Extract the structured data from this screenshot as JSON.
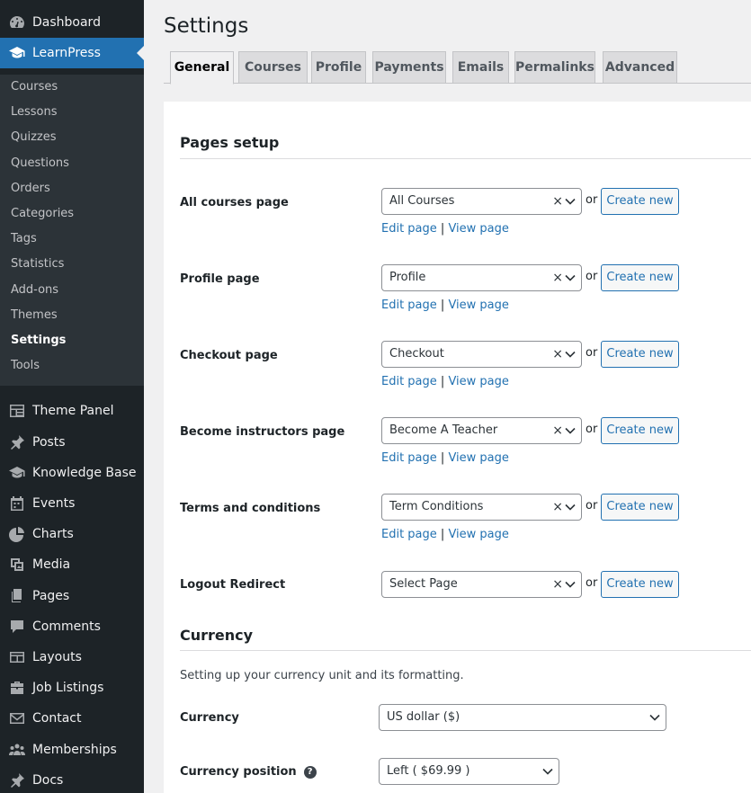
{
  "sidebar": {
    "top": [
      {
        "label": "Dashboard",
        "icon": "dashboard-icon"
      },
      {
        "label": "LearnPress",
        "icon": "graduation-cap-icon"
      }
    ],
    "submenu": [
      "Courses",
      "Lessons",
      "Quizzes",
      "Questions",
      "Orders",
      "Categories",
      "Tags",
      "Statistics",
      "Add-ons",
      "Themes",
      "Settings",
      "Tools"
    ],
    "current_submenu": "Settings",
    "bottom": [
      {
        "label": "Theme Panel",
        "icon": "theme-panel-icon"
      },
      {
        "label": "Posts",
        "icon": "pushpin-icon"
      },
      {
        "label": "Knowledge Base",
        "icon": "graduation-cap-icon"
      },
      {
        "label": "Events",
        "icon": "calendar-icon"
      },
      {
        "label": "Charts",
        "icon": "pie-chart-icon"
      },
      {
        "label": "Media",
        "icon": "media-icon"
      },
      {
        "label": "Pages",
        "icon": "pages-icon"
      },
      {
        "label": "Comments",
        "icon": "comment-icon"
      },
      {
        "label": "Layouts",
        "icon": "layouts-icon"
      },
      {
        "label": "Job Listings",
        "icon": "briefcase-icon"
      },
      {
        "label": "Contact",
        "icon": "envelope-icon"
      },
      {
        "label": "Memberships",
        "icon": "groups-icon"
      },
      {
        "label": "Docs",
        "icon": "pushpin-icon"
      }
    ]
  },
  "page": {
    "title": "Settings",
    "tabs": [
      "General",
      "Courses",
      "Profile",
      "Payments",
      "Emails",
      "Permalinks",
      "Advanced"
    ],
    "active_tab": "General"
  },
  "pages_setup": {
    "heading": "Pages setup",
    "rows": [
      {
        "label": "All courses page",
        "value": "All Courses",
        "clear": "×",
        "or": "or",
        "button": "Create new",
        "edit": "Edit page",
        "sep": "|",
        "view": "View page"
      },
      {
        "label": "Profile page",
        "value": "Profile",
        "clear": "×",
        "or": "or",
        "button": "Create new",
        "edit": "Edit page",
        "sep": "|",
        "view": "View page"
      },
      {
        "label": "Checkout page",
        "value": "Checkout",
        "clear": "×",
        "or": "or",
        "button": "Create new",
        "edit": "Edit page",
        "sep": "|",
        "view": "View page"
      },
      {
        "label": "Become instructors page",
        "value": "Become A Teacher",
        "clear": "×",
        "or": "or",
        "button": "Create new",
        "edit": "Edit page",
        "sep": "|",
        "view": "View page"
      },
      {
        "label": "Terms and conditions",
        "value": "Term Conditions",
        "clear": "×",
        "or": "or",
        "button": "Create new",
        "edit": "Edit page",
        "sep": "|",
        "view": "View page"
      },
      {
        "label": "Logout Redirect",
        "value": "Select Page",
        "clear": "×",
        "or": "or",
        "button": "Create new"
      }
    ]
  },
  "currency": {
    "heading": "Currency",
    "description": "Setting up your currency unit and its formatting.",
    "currency_label": "Currency",
    "currency_value": "US dollar ($)",
    "position_label": "Currency position",
    "position_help": "?",
    "position_value": "Left ( $69.99 )"
  },
  "colors": {
    "sidebar_bg": "#1d2327",
    "submenu_bg": "#2c3338",
    "accent": "#2271b1",
    "page_bg": "#f0f0f1"
  }
}
